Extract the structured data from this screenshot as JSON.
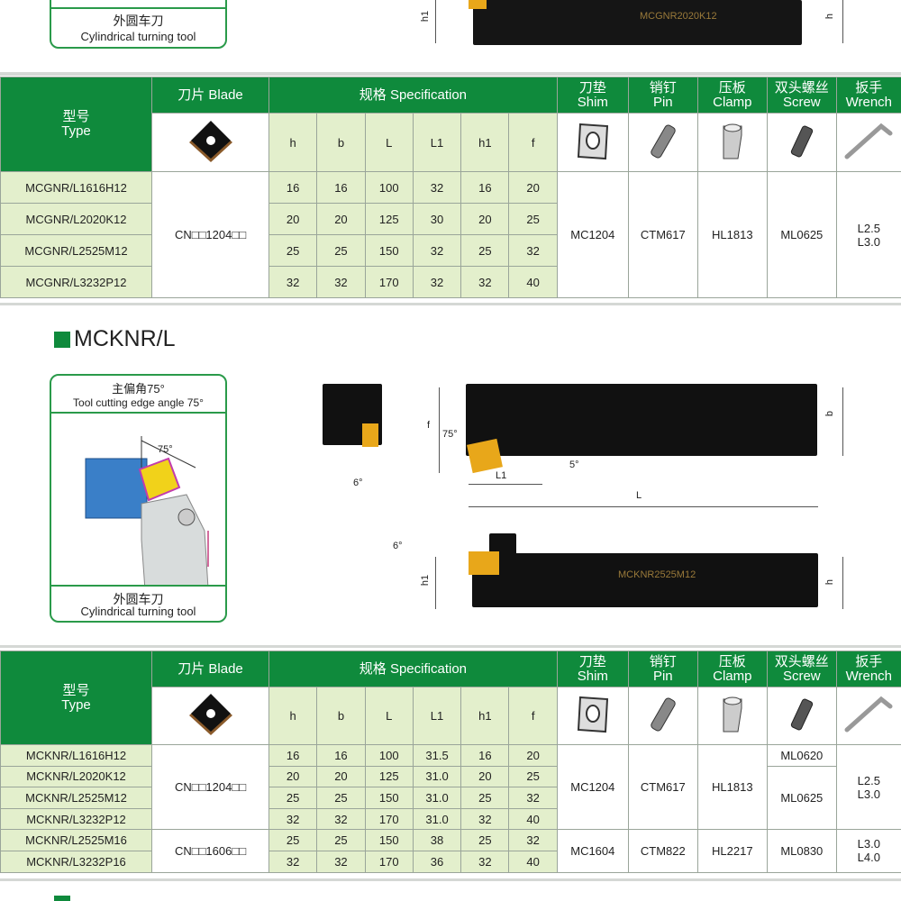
{
  "colors": {
    "header_green": "#0f8a3c",
    "cell_light_green": "#e3efcc",
    "insert_gold": "#e8a71a"
  },
  "top_section": {
    "label_cn": "外圆车刀",
    "label_en": "Cylindrical turning tool",
    "holder_marking": "MCGNR2020K12",
    "dims": {
      "h1": "h1",
      "h": "h"
    }
  },
  "headers": {
    "type_cn": "型号",
    "type_en": "Type",
    "blade": "刀片 Blade",
    "spec": "规格 Specification",
    "shim_cn": "刀垫",
    "shim_en": "Shim",
    "pin_cn": "销钉",
    "pin_en": "Pin",
    "clamp_cn": "压板",
    "clamp_en": "Clamp",
    "screw_cn": "双头螺丝",
    "screw_en": "Screw",
    "wrench_cn": "扳手",
    "wrench_en": "Wrench",
    "spec_cols": [
      "h",
      "b",
      "L",
      "L1",
      "h1",
      "f"
    ],
    "icons": [
      "insert-icon",
      "shim-icon",
      "pin-icon",
      "clamp-icon",
      "screw-icon",
      "wrench-icon"
    ]
  },
  "table1": {
    "rows": [
      {
        "type": "MCGNR/L1616H12",
        "spec": [
          "16",
          "16",
          "100",
          "32",
          "16",
          "20"
        ]
      },
      {
        "type": "MCGNR/L2020K12",
        "spec": [
          "20",
          "20",
          "125",
          "30",
          "20",
          "25"
        ]
      },
      {
        "type": "MCGNR/L2525M12",
        "spec": [
          "25",
          "25",
          "150",
          "32",
          "25",
          "32"
        ]
      },
      {
        "type": "MCGNR/L3232P12",
        "spec": [
          "32",
          "32",
          "170",
          "32",
          "32",
          "40"
        ]
      }
    ],
    "blade": "CN□□1204□□",
    "shim": "MC1204",
    "pin": "CTM617",
    "clamp": "HL1813",
    "screw": "ML0625",
    "wrench": [
      "L2.5",
      "L3.0"
    ]
  },
  "section2": {
    "title": "MCKNR/L",
    "angle_cn": "主偏角75°",
    "angle_en": "Tool cutting edge angle 75°",
    "angle_diagram": "75°",
    "label_cn": "外圆车刀",
    "label_en": "Cylindrical turning tool",
    "holder_marking": "MCKNR2525M12",
    "dims": {
      "f": "f",
      "b": "b",
      "L": "L",
      "L1": "L1",
      "h": "h",
      "h1": "h1",
      "a75": "75°",
      "a5": "5°",
      "a6_front": "6°",
      "a6_side": "6°"
    }
  },
  "table2": {
    "rows": [
      {
        "type": "MCKNR/L1616H12",
        "spec": [
          "16",
          "16",
          "100",
          "31.5",
          "16",
          "20"
        ]
      },
      {
        "type": "MCKNR/L2020K12",
        "spec": [
          "20",
          "20",
          "125",
          "31.0",
          "20",
          "25"
        ]
      },
      {
        "type": "MCKNR/L2525M12",
        "spec": [
          "25",
          "25",
          "150",
          "31.0",
          "25",
          "32"
        ]
      },
      {
        "type": "MCKNR/L3232P12",
        "spec": [
          "32",
          "32",
          "170",
          "31.0",
          "32",
          "40"
        ]
      },
      {
        "type": "MCKNR/L2525M16",
        "spec": [
          "25",
          "25",
          "150",
          "38",
          "25",
          "32"
        ]
      },
      {
        "type": "MCKNR/L3232P16",
        "spec": [
          "32",
          "32",
          "170",
          "36",
          "32",
          "40"
        ]
      }
    ],
    "groups": [
      {
        "blade": "CN□□1204□□",
        "shim": "MC1204",
        "pin": "CTM617",
        "clamp": "HL1813",
        "screws": [
          "ML0620",
          "ML0625"
        ],
        "wrench": [
          "L2.5",
          "L3.0"
        ]
      },
      {
        "blade": "CN□□1606□□",
        "shim": "MC1604",
        "pin": "CTM822",
        "clamp": "HL2217",
        "screw": "ML0830",
        "wrench": [
          "L3.0",
          "L4.0"
        ]
      }
    ]
  }
}
